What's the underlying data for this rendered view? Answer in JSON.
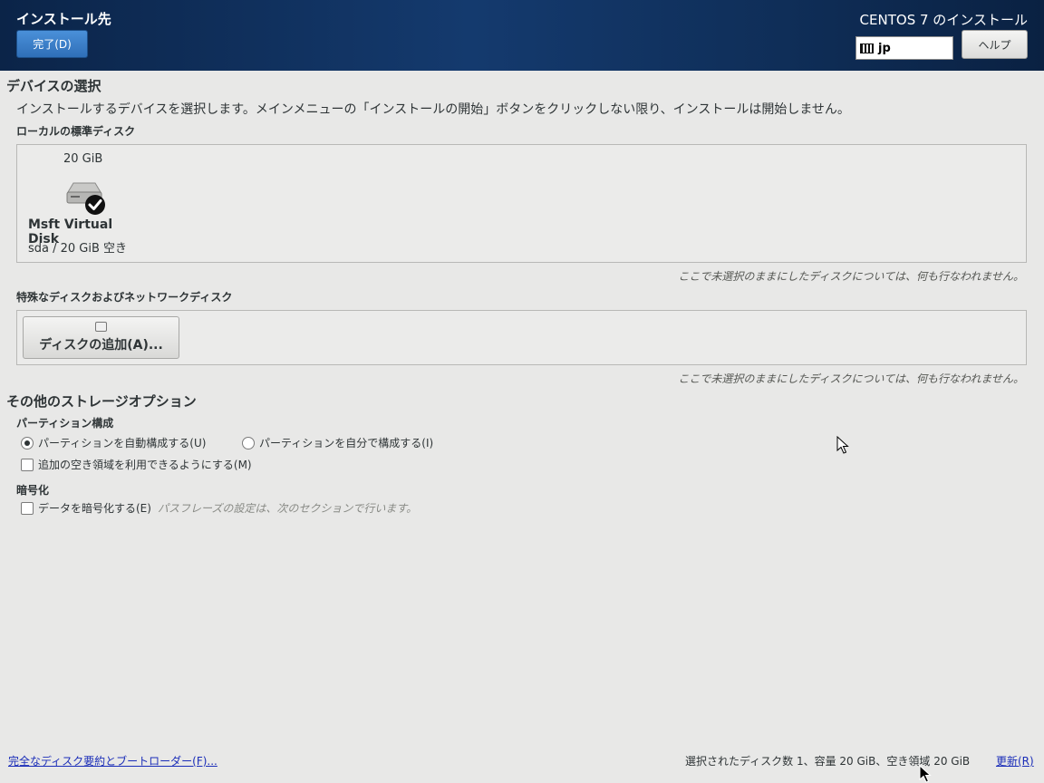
{
  "header": {
    "title": "インストール先",
    "done_label": "完了(D)",
    "product_title": "CENTOS 7 のインストール",
    "keyboard_layout": "jp",
    "help_label": "ヘルプ"
  },
  "device_selection": {
    "heading": "デバイスの選択",
    "description": "インストールするデバイスを選択します。メインメニューの「インストールの開始」ボタンをクリックしない限り、インストールは開始しません。",
    "local_disks_heading": "ローカルの標準ディスク",
    "disks": [
      {
        "size": "20 GiB",
        "name": "Msft Virtual Disk",
        "detail": "sda  /  20 GiB 空き",
        "selected": true
      }
    ],
    "unselected_hint": "ここで未選択のままにしたディスクについては、何も行なわれません。",
    "special_disks_heading": "特殊なディスクおよびネットワークディスク",
    "add_disk_label": "ディスクの追加(A)...",
    "special_unselected_hint": "ここで未選択のままにしたディスクについては、何も行なわれません。"
  },
  "storage_options": {
    "heading": "その他のストレージオプション",
    "partitioning_heading": "パーティション構成",
    "auto_partition_label": "パーティションを自動構成する(U)",
    "manual_partition_label": "パーティションを自分で構成する(I)",
    "extra_space_label": "追加の空き領域を利用できるようにする(M)",
    "encryption_heading": "暗号化",
    "encrypt_label": "データを暗号化する(E)",
    "encrypt_note": "パスフレーズの設定は、次のセクションで行います。"
  },
  "footer": {
    "summary_link": "完全なディスク要約とブートローダー(F)...",
    "status": "選択されたディスク数 1、容量 20 GiB、空き領域 20 GiB",
    "refresh_label": "更新(R)"
  },
  "colors": {
    "header_bg": "#143a6e",
    "primary_button": "#3b80cc",
    "link": "#1a2db8"
  }
}
